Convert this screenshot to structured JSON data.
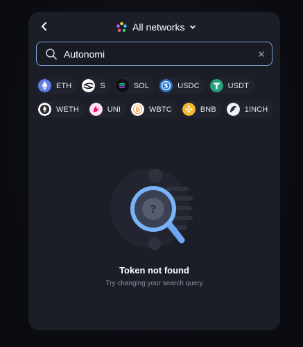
{
  "header": {
    "network_label": "All networks"
  },
  "search": {
    "value": "Autonomi"
  },
  "tokens": [
    {
      "symbol": "ETH",
      "color": "#627eea",
      "icon": "ethereum-icon"
    },
    {
      "symbol": "S",
      "color": "#ffffff",
      "icon": "sonic-icon"
    },
    {
      "symbol": "SOL",
      "color": "#14f195",
      "icon": "solana-icon"
    },
    {
      "symbol": "USDC",
      "color": "#2775ca",
      "icon": "usdc-icon"
    },
    {
      "symbol": "USDT",
      "color": "#26a17b",
      "icon": "tether-icon"
    },
    {
      "symbol": "WETH",
      "color": "#ffffff",
      "icon": "weth-icon"
    },
    {
      "symbol": "UNI",
      "color": "#ff007a",
      "icon": "uniswap-icon"
    },
    {
      "symbol": "WBTC",
      "color": "#f7931a",
      "icon": "wbtc-icon"
    },
    {
      "symbol": "BNB",
      "color": "#f3ba2f",
      "icon": "bnb-icon"
    },
    {
      "symbol": "1INCH",
      "color": "#d82122",
      "icon": "1inch-icon"
    }
  ],
  "empty_state": {
    "title": "Token not found",
    "subtitle": "Try changing your search query",
    "icon": "magnifier-question-icon"
  },
  "colors": {
    "panel_bg": "#1b1e27",
    "accent": "#7fa2d8",
    "chip_bg": "#20232d"
  }
}
